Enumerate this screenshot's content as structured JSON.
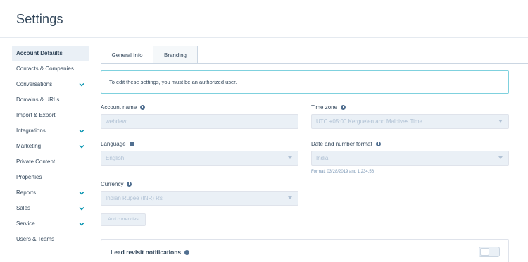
{
  "header": {
    "title": "Settings"
  },
  "sidebar": {
    "items": [
      {
        "label": "Account Defaults",
        "active": true,
        "expandable": false
      },
      {
        "label": "Contacts & Companies",
        "active": false,
        "expandable": false
      },
      {
        "label": "Conversations",
        "active": false,
        "expandable": true
      },
      {
        "label": "Domains & URLs",
        "active": false,
        "expandable": false
      },
      {
        "label": "Import & Export",
        "active": false,
        "expandable": false
      },
      {
        "label": "Integrations",
        "active": false,
        "expandable": true
      },
      {
        "label": "Marketing",
        "active": false,
        "expandable": true
      },
      {
        "label": "Private Content",
        "active": false,
        "expandable": false
      },
      {
        "label": "Properties",
        "active": false,
        "expandable": false
      },
      {
        "label": "Reports",
        "active": false,
        "expandable": true
      },
      {
        "label": "Sales",
        "active": false,
        "expandable": true
      },
      {
        "label": "Service",
        "active": false,
        "expandable": true
      },
      {
        "label": "Users & Teams",
        "active": false,
        "expandable": false
      }
    ]
  },
  "tabs": [
    {
      "label": "General Info",
      "active": true
    },
    {
      "label": "Branding",
      "active": false
    }
  ],
  "notice": "To edit these settings, you must be an authorized user.",
  "form": {
    "account_name": {
      "label": "Account name",
      "value": "webdew"
    },
    "time_zone": {
      "label": "Time zone",
      "value": "UTC +05:00 Kerguelen and Maldives Time"
    },
    "language": {
      "label": "Language",
      "value": "English"
    },
    "date_format": {
      "label": "Date and number format",
      "value": "India",
      "hint": "Format: 03/28/2019 and 1,234.56"
    },
    "currency": {
      "label": "Currency",
      "value": "Indian Rupee (INR) Rs"
    },
    "add_currencies": "Add currencies"
  },
  "lead_revisit": {
    "label": "Lead revisit notifications",
    "enabled": false
  },
  "colors": {
    "accent": "#0091ae",
    "notice_border": "#7fd1de",
    "disabled_bg": "#eaf0f6"
  },
  "icons": {
    "expand": "chevron-down-icon",
    "info": "info-icon",
    "dropdown": "caret-down-icon"
  }
}
